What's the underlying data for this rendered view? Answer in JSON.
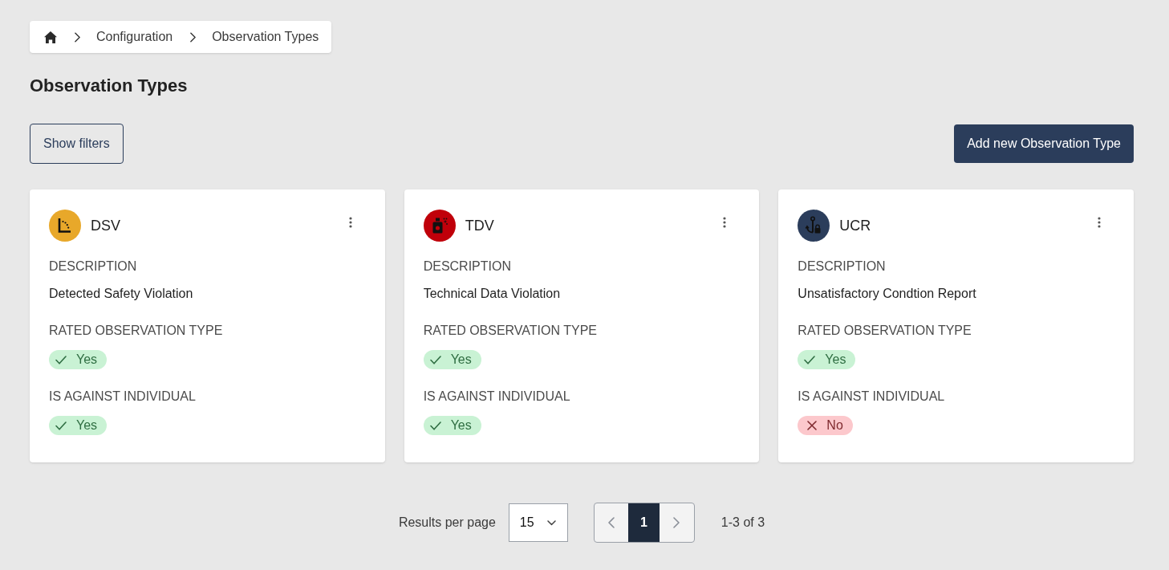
{
  "breadcrumb": {
    "items": [
      {
        "label": "Configuration"
      },
      {
        "label": "Observation Types"
      }
    ]
  },
  "page_title": "Observation Types",
  "toolbar": {
    "filter_button": "Show filters",
    "add_button": "Add new Observation Type"
  },
  "cards": [
    {
      "title": "DSV",
      "avatar": {
        "kind": "angle",
        "color": "#e8a82a"
      },
      "fields": [
        {
          "kind": "text",
          "label": "DESCRIPTION",
          "value": "Detected Safety Violation"
        },
        {
          "kind": "badge",
          "label": "RATED OBSERVATION TYPE",
          "value": "Yes",
          "on": true
        },
        {
          "kind": "badge",
          "label": "IS AGAINST INDIVIDUAL",
          "value": "Yes",
          "on": true
        }
      ]
    },
    {
      "title": "TDV",
      "avatar": {
        "kind": "spray",
        "color": "#c0000a"
      },
      "fields": [
        {
          "kind": "text",
          "label": "DESCRIPTION",
          "value": "Technical Data Violation"
        },
        {
          "kind": "badge",
          "label": "RATED OBSERVATION TYPE",
          "value": "Yes",
          "on": true
        },
        {
          "kind": "badge",
          "label": "IS AGAINST INDIVIDUAL",
          "value": "Yes",
          "on": true
        }
      ]
    },
    {
      "title": "UCR",
      "avatar": {
        "kind": "anchor",
        "color": "#2b3d5b"
      },
      "fields": [
        {
          "kind": "text",
          "label": "DESCRIPTION",
          "value": "Unsatisfactory Condtion Report"
        },
        {
          "kind": "badge",
          "label": "RATED OBSERVATION TYPE",
          "value": "Yes",
          "on": true
        },
        {
          "kind": "badge",
          "label": "IS AGAINST INDIVIDUAL",
          "value": "No",
          "on": false
        }
      ]
    }
  ],
  "pagination": {
    "per_page_label": "Results per page",
    "per_page": "15",
    "pages": [
      {
        "label": "1",
        "selected": true
      }
    ],
    "range": "1-3 of 3"
  }
}
